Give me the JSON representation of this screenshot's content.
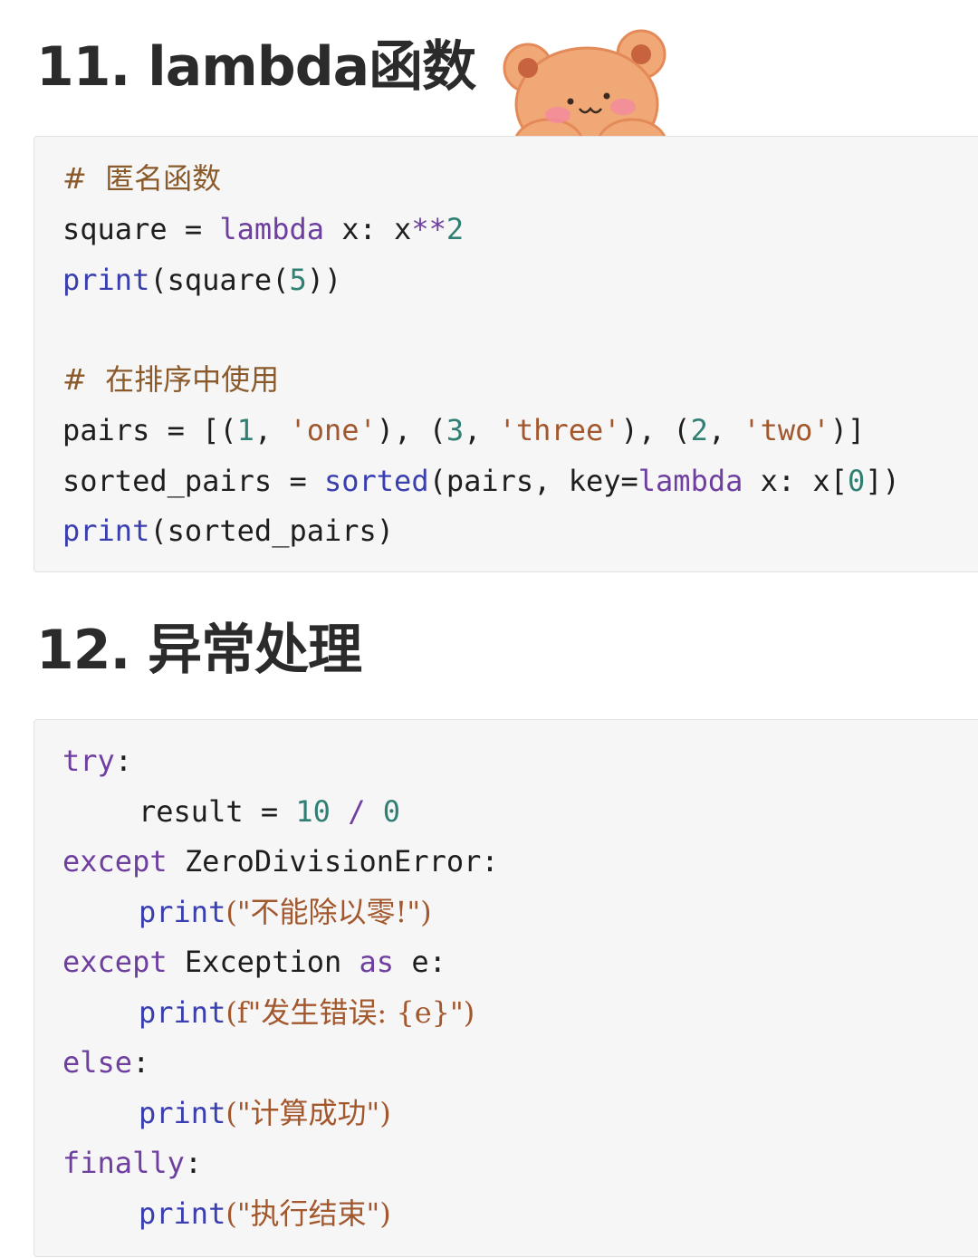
{
  "section1": {
    "heading": "11. lambda函数",
    "code": {
      "comment1": "#  匿名函数",
      "l2_var": "square",
      "l2_eq": " = ",
      "l2_kw": "lambda",
      "l2_rest": " x: x",
      "l2_op": "**",
      "l2_num": "2",
      "l3_fn": "print",
      "l3_a": "(square(",
      "l3_num": "5",
      "l3_b": "))",
      "comment2": "#  在排序中使用",
      "l6_var": "pairs",
      "l6_eq": " = [(",
      "l6_n1": "1",
      "l6_s1": "'one'",
      "l6_n3": "3",
      "l6_s3": "'three'",
      "l6_n2": "2",
      "l6_s2": "'two'",
      "l7_var": "sorted_pairs",
      "l7_eq": " = ",
      "l7_fn": "sorted",
      "l7_a": "(pairs, key=",
      "l7_kw": "lambda",
      "l7_b": " x: x[",
      "l7_num": "0",
      "l7_c": "])",
      "l8_fn": "print",
      "l8_a": "(sorted_pairs)"
    }
  },
  "section2": {
    "heading": "12. 异常处理",
    "code": {
      "l1_kw": "try",
      "l1_a": ":",
      "l2_a": "result = ",
      "l2_n1": "10",
      "l2_op": " / ",
      "l2_n2": "0",
      "l3_kw": "except",
      "l3_a": " ZeroDivisionError:",
      "l4_fn": "print",
      "l4_str": "(\"不能除以零!\")",
      "l5_kw": "except",
      "l5_a": " Exception ",
      "l5_kw2": "as",
      "l5_b": " e:",
      "l6_fn": "print",
      "l6_str": "(f\"发生错误: {e}\")",
      "l7_kw": "else",
      "l7_a": ":",
      "l8_fn": "print",
      "l8_str": "(\"计算成功\")",
      "l9_kw": "finally",
      "l9_a": ":",
      "l10_fn": "print",
      "l10_str": "(\"执行结束\")"
    }
  },
  "colors": {
    "keyword": "#6f3fa0",
    "function": "#3a3fb0",
    "string": "#a2572d",
    "number": "#2f7f73",
    "comment": "#8a5a2b",
    "block_bg": "#f6f6f6"
  },
  "sticker": {
    "icon": "teddy-bear-icon"
  }
}
